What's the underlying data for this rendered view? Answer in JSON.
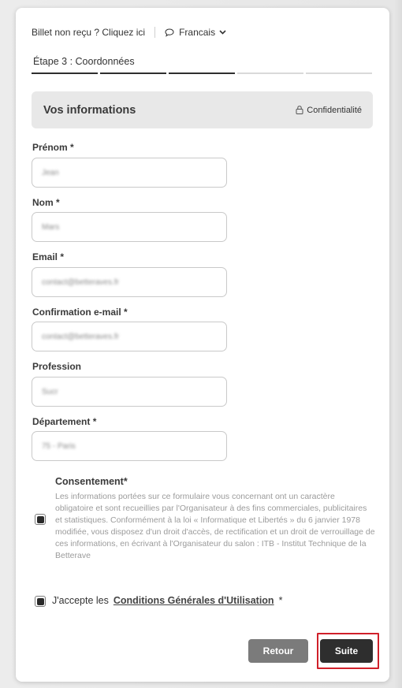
{
  "topbar": {
    "ticket_link": "Billet non reçu ? Cliquez ici",
    "language": "Francais",
    "bubble_icon": "chat-bubble-icon",
    "chevron_icon": "chevron-down-icon"
  },
  "step": {
    "label": "Étape 3 : Coordonnées",
    "current": 3,
    "total": 5
  },
  "section": {
    "title": "Vos informations",
    "privacy_label": "Confidentialité",
    "privacy_icon": "lock-icon"
  },
  "fields": {
    "firstname": {
      "label": "Prénom *",
      "value": "Jean"
    },
    "lastname": {
      "label": "Nom *",
      "value": "Mars"
    },
    "email": {
      "label": "Email *",
      "value": "contact@betteraves.fr"
    },
    "email_confirm": {
      "label": "Confirmation e-mail *",
      "value": "contact@betteraves.fr"
    },
    "profession": {
      "label": "Profession",
      "value": "Sucr"
    },
    "department": {
      "label": "Département *",
      "value": "75 - Paris"
    }
  },
  "consent": {
    "title": "Consentement*",
    "text": "Les informations portées sur ce formulaire vous concernant ont un caractère obligatoire et sont recueillies par l'Organisateur à des fins commerciales, publicitaires et statistiques. Conformément à la loi « Informatique et Libertés » du 6 janvier 1978 modifiée, vous disposez d'un droit d'accès, de rectification et un droit de verrouillage de ces informations, en écrivant à l'Organisateur du salon : ITB - Institut Technique de la Betterave",
    "checked": true
  },
  "cgu": {
    "prefix": "J'accepte les",
    "link": "Conditions Générales d'Utilisation",
    "suffix": "*",
    "checked": true
  },
  "buttons": {
    "back": "Retour",
    "next": "Suite"
  },
  "colors": {
    "primary_button": "#2e2e2e",
    "secondary_button": "#7b7b7b",
    "highlight": "#d0202a"
  }
}
